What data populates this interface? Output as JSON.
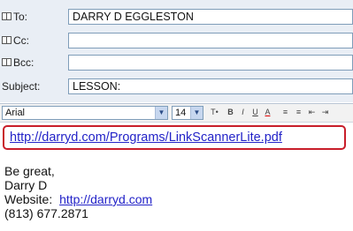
{
  "header": {
    "to": {
      "label": "To:",
      "value": "DARRY D EGGLESTON"
    },
    "cc": {
      "label": "Cc:",
      "value": ""
    },
    "bcc": {
      "label": "Bcc:",
      "value": ""
    },
    "subject": {
      "label": "Subject:",
      "value": "LESSON:"
    }
  },
  "toolbar": {
    "font": "Arial",
    "size": "14",
    "buttons": [
      "B",
      "I",
      "U",
      "A"
    ]
  },
  "body": {
    "link": "http://darryd.com/Programs/LinkScannerLite.pdf",
    "signature": {
      "line1": "Be great,",
      "line2": "Darry D",
      "website_label": "Website:",
      "website_link": "http://darryd.com",
      "phone": "(813) 677.2871"
    }
  },
  "colors": {
    "header_bg": "#e9eef5",
    "link": "#2323c8",
    "highlight_border": "#c81e2a"
  }
}
